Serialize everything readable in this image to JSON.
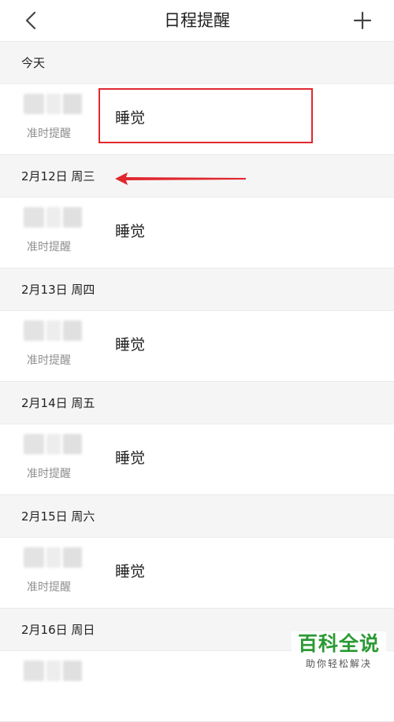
{
  "nav": {
    "title": "日程提醒",
    "back_icon": "chevron-left-icon",
    "add_icon": "plus-icon"
  },
  "sections": [
    {
      "header": "今天",
      "items": [
        {
          "title": "睡觉",
          "subtitle": "准时提醒"
        }
      ]
    },
    {
      "header": "2月12日 周三",
      "items": [
        {
          "title": "睡觉",
          "subtitle": "准时提醒"
        }
      ]
    },
    {
      "header": "2月13日 周四",
      "items": [
        {
          "title": "睡觉",
          "subtitle": "准时提醒"
        }
      ]
    },
    {
      "header": "2月14日 周五",
      "items": [
        {
          "title": "睡觉",
          "subtitle": "准时提醒"
        }
      ]
    },
    {
      "header": "2月15日 周六",
      "items": [
        {
          "title": "睡觉",
          "subtitle": "准时提醒"
        }
      ]
    },
    {
      "header": "2月16日 周日",
      "items": [
        {
          "title": "",
          "subtitle": ""
        }
      ]
    }
  ],
  "annotation": {
    "highlight_color": "#e0282e",
    "arrow_color": "#e0282e"
  },
  "watermark": {
    "main": "百科全说",
    "sub": "助你轻松解决"
  }
}
